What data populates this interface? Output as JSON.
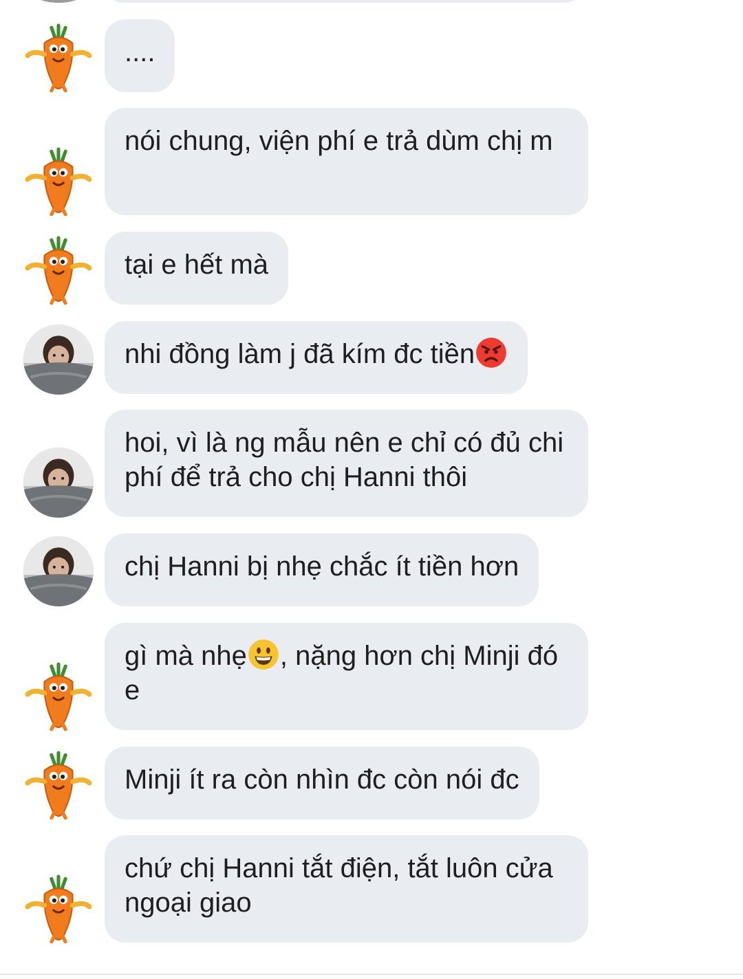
{
  "messages": [
    {
      "sender": "carrot",
      "text": "...."
    },
    {
      "sender": "carrot",
      "text": "nói chung, viện phí e trả dùm chị m"
    },
    {
      "sender": "carrot",
      "text": "tại e hết mà"
    },
    {
      "sender": "photo",
      "text": "nhi đồng làm j đã kím đc tiền",
      "emoji": "angry-face-emoji"
    },
    {
      "sender": "photo",
      "text": "hoi, vì là ng mẫu nên e chỉ có đủ chi phí để trả cho chị Hanni thôi"
    },
    {
      "sender": "photo",
      "text": "chị Hanni bị nhẹ chắc ít tiền hơn"
    },
    {
      "sender": "carrot",
      "text_before": "gì mà nhẹ",
      "emoji": "grinning-face-emoji",
      "text_after": ", nặng hơn chị Minji đó e"
    },
    {
      "sender": "carrot",
      "text": "Minji ít ra còn nhìn đc còn nói đc"
    },
    {
      "sender": "carrot",
      "text": "chứ chị Hanni tắt điện, tắt luôn cửa ngoại giao"
    }
  ],
  "colors": {
    "bubble": "#e9ecf1",
    "text": "#1c1e21",
    "carrot": "#f07c1e",
    "leaves": "#3f8e2e"
  }
}
